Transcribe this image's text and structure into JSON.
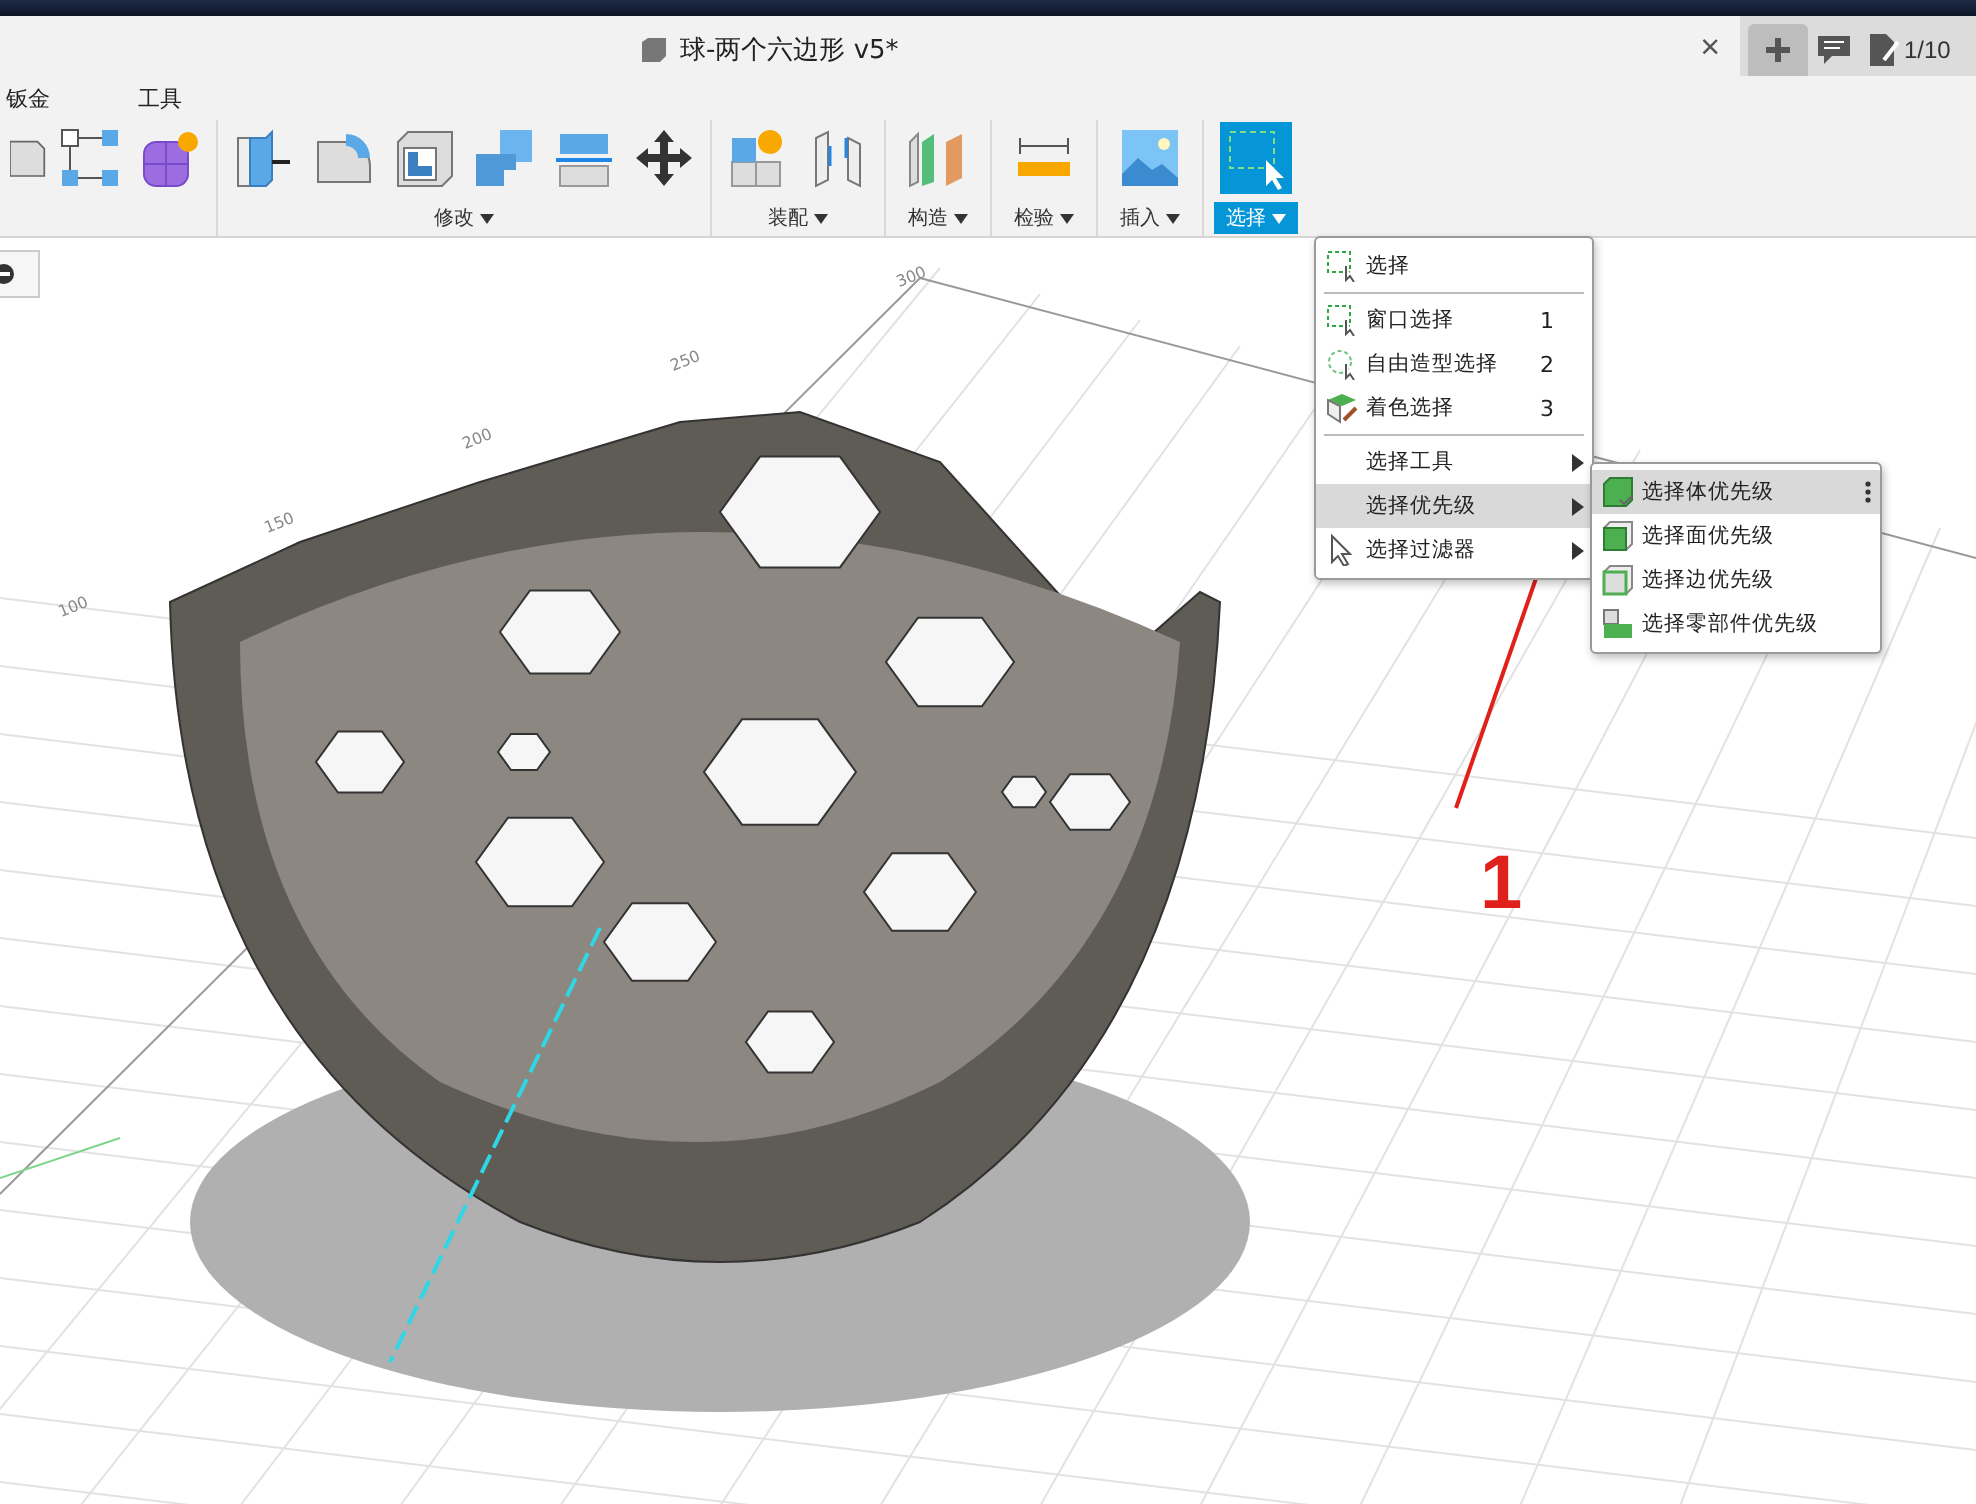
{
  "document_tab": {
    "title": "球-两个六边形 v5*",
    "close": "×"
  },
  "header": {
    "page_count": "1/10"
  },
  "toolbar": {
    "tab_labels": [
      "钣金",
      "工具"
    ],
    "groups": [
      {
        "label": "修改",
        "selected": false
      },
      {
        "label": "装配",
        "selected": false
      },
      {
        "label": "构造",
        "selected": false
      },
      {
        "label": "检验",
        "selected": false
      },
      {
        "label": "插入",
        "selected": false
      },
      {
        "label": "选择",
        "selected": true
      }
    ]
  },
  "select_menu": {
    "items": [
      {
        "kind": "item",
        "label": "选择"
      },
      {
        "kind": "separator"
      },
      {
        "kind": "item",
        "label": "窗口选择",
        "shortcut": "1"
      },
      {
        "kind": "item",
        "label": "自由造型选择",
        "shortcut": "2"
      },
      {
        "kind": "item",
        "label": "着色选择",
        "shortcut": "3"
      },
      {
        "kind": "separator"
      },
      {
        "kind": "submenu",
        "label": "选择工具",
        "selected": false
      },
      {
        "kind": "submenu",
        "label": "选择优先级",
        "selected": true
      },
      {
        "kind": "submenu",
        "label": "选择过滤器",
        "selected": false
      }
    ]
  },
  "priority_submenu": {
    "items": [
      {
        "label": "选择体优先级",
        "selected": true
      },
      {
        "label": "选择面优先级",
        "selected": false
      },
      {
        "label": "选择边优先级",
        "selected": false
      },
      {
        "label": "选择零部件优先级",
        "selected": false
      }
    ]
  },
  "viewport": {
    "grid_labels": [
      "300",
      "250",
      "200",
      "150",
      "100"
    ]
  },
  "annotation": {
    "number": "1"
  }
}
